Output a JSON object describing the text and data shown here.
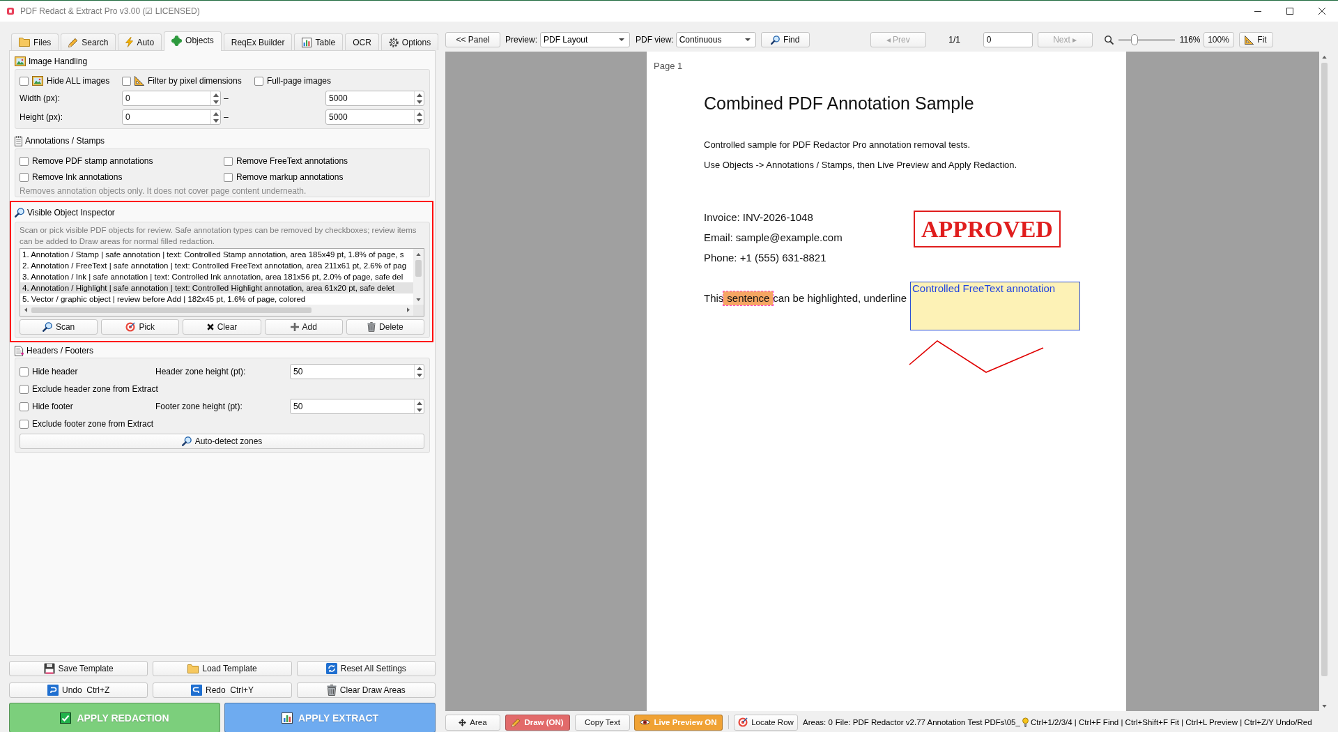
{
  "window": {
    "title": "PDF Redact & Extract Pro v3.00 (☑ LICENSED)"
  },
  "tabs": [
    {
      "label": "Files",
      "selected": false
    },
    {
      "label": "Search",
      "selected": false
    },
    {
      "label": "Auto",
      "selected": false
    },
    {
      "label": "Objects",
      "selected": true
    },
    {
      "label": "ReqEx Builder",
      "selected": false
    },
    {
      "label": "Table",
      "selected": false
    },
    {
      "label": "OCR",
      "selected": false
    },
    {
      "label": "Options",
      "selected": false
    }
  ],
  "image_handling": {
    "title": "Image Handling",
    "options": [
      {
        "label": "Hide ALL images",
        "checked": false
      },
      {
        "label": "Filter by pixel dimensions",
        "checked": false
      },
      {
        "label": "Full-page images",
        "checked": false
      }
    ],
    "ranges": [
      {
        "label": "Width (px):",
        "min": "0",
        "separator": "–",
        "max": "5000"
      },
      {
        "label": "Height (px):",
        "min": "0",
        "separator": "–",
        "max": "5000"
      }
    ]
  },
  "annotations": {
    "title": "Annotations / Stamps",
    "options": [
      {
        "label": "Remove PDF stamp annotations",
        "checked": false
      },
      {
        "label": "Remove FreeText annotations",
        "checked": false
      },
      {
        "label": "Remove Ink annotations",
        "checked": false
      },
      {
        "label": "Remove markup annotations",
        "checked": false
      }
    ],
    "hint": "Removes annotation objects only. It does not cover page content underneath."
  },
  "inspector": {
    "title": "Visible Object Inspector",
    "highlighted": true,
    "description": "Scan or pick visible PDF objects for review. Safe annotation types can be removed by checkboxes; review items can be added to Draw areas for normal filled redaction.",
    "items": [
      {
        "text": "1. Annotation / Stamp | safe annotation | text: Controlled Stamp annotation, area 185x49 pt, 1.8% of page, s",
        "selected": false
      },
      {
        "text": "2. Annotation / FreeText | safe annotation | text: Controlled FreeText annotation, area 211x61 pt, 2.6% of pag",
        "selected": false
      },
      {
        "text": "3. Annotation / Ink | safe annotation | text: Controlled Ink annotation, area 181x56 pt, 2.0% of page, safe del",
        "selected": false
      },
      {
        "text": "4. Annotation / Highlight | safe annotation | text: Controlled Highlight annotation, area 61x20 pt, safe delet",
        "selected": true
      },
      {
        "text": "5. Vector / graphic object | review before Add | 182x45 pt, 1.6% of page, colored",
        "selected": false
      }
    ],
    "buttons": [
      "Scan",
      "Pick",
      "Clear",
      "Add",
      "Delete"
    ]
  },
  "headers_footers": {
    "title": "Headers / Footers",
    "rows": [
      {
        "label": "Hide header",
        "checked": false,
        "field": {
          "label": "Header zone height (pt):",
          "value": "50"
        }
      },
      {
        "label": "Exclude header zone from Extract",
        "checked": false
      },
      {
        "label": "Hide footer",
        "checked": false,
        "field": {
          "label": "Footer zone height (pt):",
          "value": "50"
        }
      },
      {
        "label": "Exclude footer zone from Extract",
        "checked": false
      }
    ],
    "button": "Auto-detect zones"
  },
  "template_buttons": [
    "Save Template",
    "Load Template",
    "Reset All Settings",
    "Undo  Ctrl+Z",
    "Redo  Ctrl+Y",
    "Clear Draw Areas"
  ],
  "apply_buttons": [
    {
      "label": "APPLY REDACTION",
      "color": "#7ccf7c"
    },
    {
      "label": "APPLY EXTRACT",
      "color": "#6eabf0"
    }
  ],
  "toolbar": {
    "panel_button": "<< Panel",
    "preview": {
      "label": "Preview:",
      "value": "PDF Layout"
    },
    "view": {
      "label": "PDF view:",
      "value": "Continuous"
    },
    "find_button": "Find",
    "prev": {
      "label": "◂ Prev",
      "disabled": true
    },
    "page_count": "1/1",
    "page_input": "0",
    "next": {
      "label": "Next ▸",
      "disabled": true
    },
    "zoom": {
      "level": 0.26,
      "reading": "116%"
    },
    "zoom_reset": "100%",
    "fit_button": "Fit"
  },
  "document": {
    "page_label": "Page 1",
    "title": "Combined PDF Annotation Sample",
    "intro": [
      "Controlled sample for PDF Redactor Pro annotation removal tests.",
      "Use Objects -> Annotations / Stamps, then Live Preview and Apply Redaction."
    ],
    "contact": [
      "Invoice: INV-2026-1048",
      "Email: sample@example.com",
      "Phone: +1 (555) 631-8821"
    ],
    "highlight_line": {
      "before": "This",
      "highlighted": "sentence",
      "after": "can be highlighted, underline"
    },
    "stamp": "APPROVED",
    "freetext": "Controlled FreeText annotation"
  },
  "status_bar": {
    "buttons": [
      {
        "label": "Area",
        "on": false
      },
      {
        "label": "Draw (ON)",
        "on": true,
        "color": "#e26a6a"
      },
      {
        "label": "Copy Text",
        "on": false
      },
      {
        "label": "Live Preview ON",
        "on": true,
        "color": "#f0a234"
      }
    ],
    "locate_button": "Locate Row",
    "areas": "Areas: 0",
    "file": "File: PDF Redactor v2.77 Annotation Test PDFs\\05_",
    "shortcuts": "Ctrl+1/2/3/4 | Ctrl+F Find | Ctrl+Shift+F Fit | Ctrl+L Preview | Ctrl+Z/Y Undo/Red"
  }
}
